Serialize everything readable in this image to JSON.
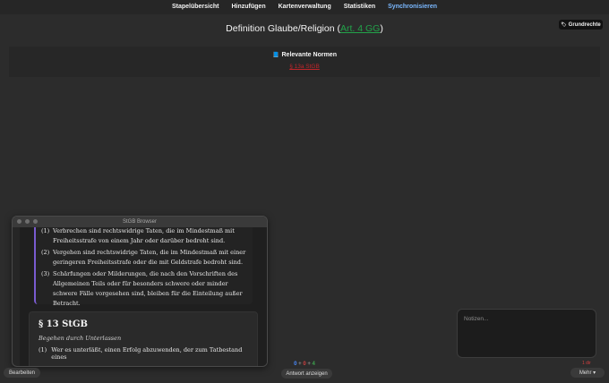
{
  "nav": {
    "items": [
      "Stapelübersicht",
      "Hinzufügen",
      "Kartenverwaltung",
      "Statistiken",
      "Synchronisieren"
    ],
    "active_index": 4,
    "active_color": "#7ab8ff"
  },
  "tag_button": {
    "icon": "tag-icon",
    "label": "Grundrechte"
  },
  "card": {
    "title_prefix": "Definition Glaube/Religion (",
    "title_link": "Art. 4 GG",
    "title_suffix": ")",
    "link_color": "#22a34a",
    "norms_heading": "Relevante Normen",
    "norms_icon": "book-icon",
    "norm_link": "§ 13a StGB",
    "norm_link_color": "#c0262b"
  },
  "browser": {
    "window_title": "StGB Browser",
    "paragraphs": [
      {
        "num": "(1)",
        "text": "Verbrechen sind rechtswidrige Taten, die im Mindestmaß mit Freiheitsstrafe von einem Jahr oder darüber bedroht sind."
      },
      {
        "num": "(2)",
        "text": "Vergehen sind rechtswidrige Taten, die im Mindestmaß mit einer geringeren Freiheitsstrafe oder die mit Geldstrafe bedroht sind."
      },
      {
        "num": "(3)",
        "text": "Schärfungen oder Milderungen, die nach den Vorschriften des Allgemeinen Teils oder für besonders schwere oder minder schwere Fälle vorgesehen sind, bleiben für die Einteilung außer Betracht."
      }
    ],
    "section_title": "§ 13 StGB",
    "section_subtitle": "Begehen durch Unterlassen",
    "section_para_num": "(1)",
    "section_para_text": "Wer es unterläßt, einen Erfolg abzuwenden, der zum Tatbestand eines"
  },
  "notes": {
    "placeholder": "Notizen..."
  },
  "bottom": {
    "edit_label": "Bearbeiten",
    "show_answer_label": "Antwort anzeigen",
    "more_label": "Mehr ▾",
    "counts": {
      "new": "0",
      "learn": "0",
      "review": "4",
      "sep": "+"
    },
    "due_label": "1 dir"
  }
}
